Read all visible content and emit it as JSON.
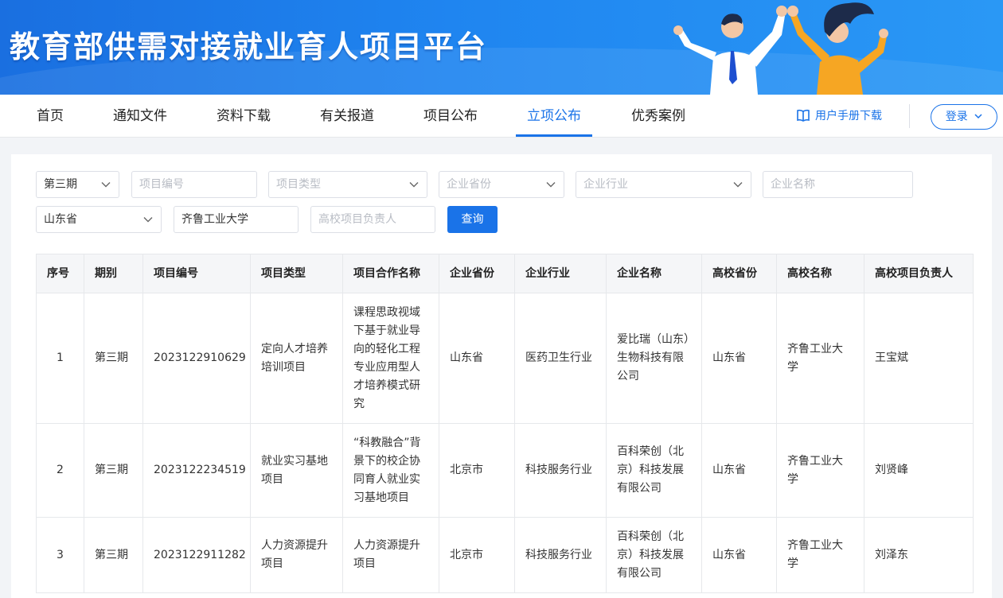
{
  "header": {
    "title": "教育部供需对接就业育人项目平台"
  },
  "nav": {
    "items": [
      "首页",
      "通知文件",
      "资料下载",
      "有关报道",
      "项目公布",
      "立项公布",
      "优秀案例"
    ],
    "active": "立项公布",
    "manual_label": "用户手册下载",
    "login_label": "登录"
  },
  "filters": {
    "period": {
      "value": "第三期"
    },
    "project_no": {
      "placeholder": "项目编号"
    },
    "project_type": {
      "placeholder": "项目类型"
    },
    "company_province": {
      "placeholder": "企业省份"
    },
    "company_industry": {
      "placeholder": "企业行业"
    },
    "company_name": {
      "placeholder": "企业名称"
    },
    "school_province": {
      "value": "山东省"
    },
    "school_name": {
      "value": "齐鲁工业大学"
    },
    "school_leader": {
      "placeholder": "高校项目负责人"
    },
    "query_label": "查询"
  },
  "table": {
    "headers": [
      "序号",
      "期别",
      "项目编号",
      "项目类型",
      "项目合作名称",
      "企业省份",
      "企业行业",
      "企业名称",
      "高校省份",
      "高校名称",
      "高校项目负责人"
    ],
    "rows": [
      [
        "1",
        "第三期",
        "2023122910629",
        "定向人才培养培训项目",
        "课程思政视域下基于就业导向的轻化工程专业应用型人才培养模式研究",
        "山东省",
        "医药卫生行业",
        "爱比瑞（山东）生物科技有限公司",
        "山东省",
        "齐鲁工业大学",
        "王宝斌"
      ],
      [
        "2",
        "第三期",
        "2023122234519",
        "就业实习基地项目",
        "“科教融合”背景下的校企协同育人就业实习基地项目",
        "北京市",
        "科技服务行业",
        "百科荣创（北京）科技发展有限公司",
        "山东省",
        "齐鲁工业大学",
        "刘贤峰"
      ],
      [
        "3",
        "第三期",
        "2023122911282",
        "人力资源提升项目",
        "人力资源提升项目",
        "北京市",
        "科技服务行业",
        "百科荣创（北京）科技发展有限公司",
        "山东省",
        "齐鲁工业大学",
        "刘泽东"
      ]
    ]
  },
  "colors": {
    "primary": "#1a73e8",
    "banner": "#1f85f0"
  },
  "icons": [
    "book-icon",
    "chevron-down-icon"
  ]
}
